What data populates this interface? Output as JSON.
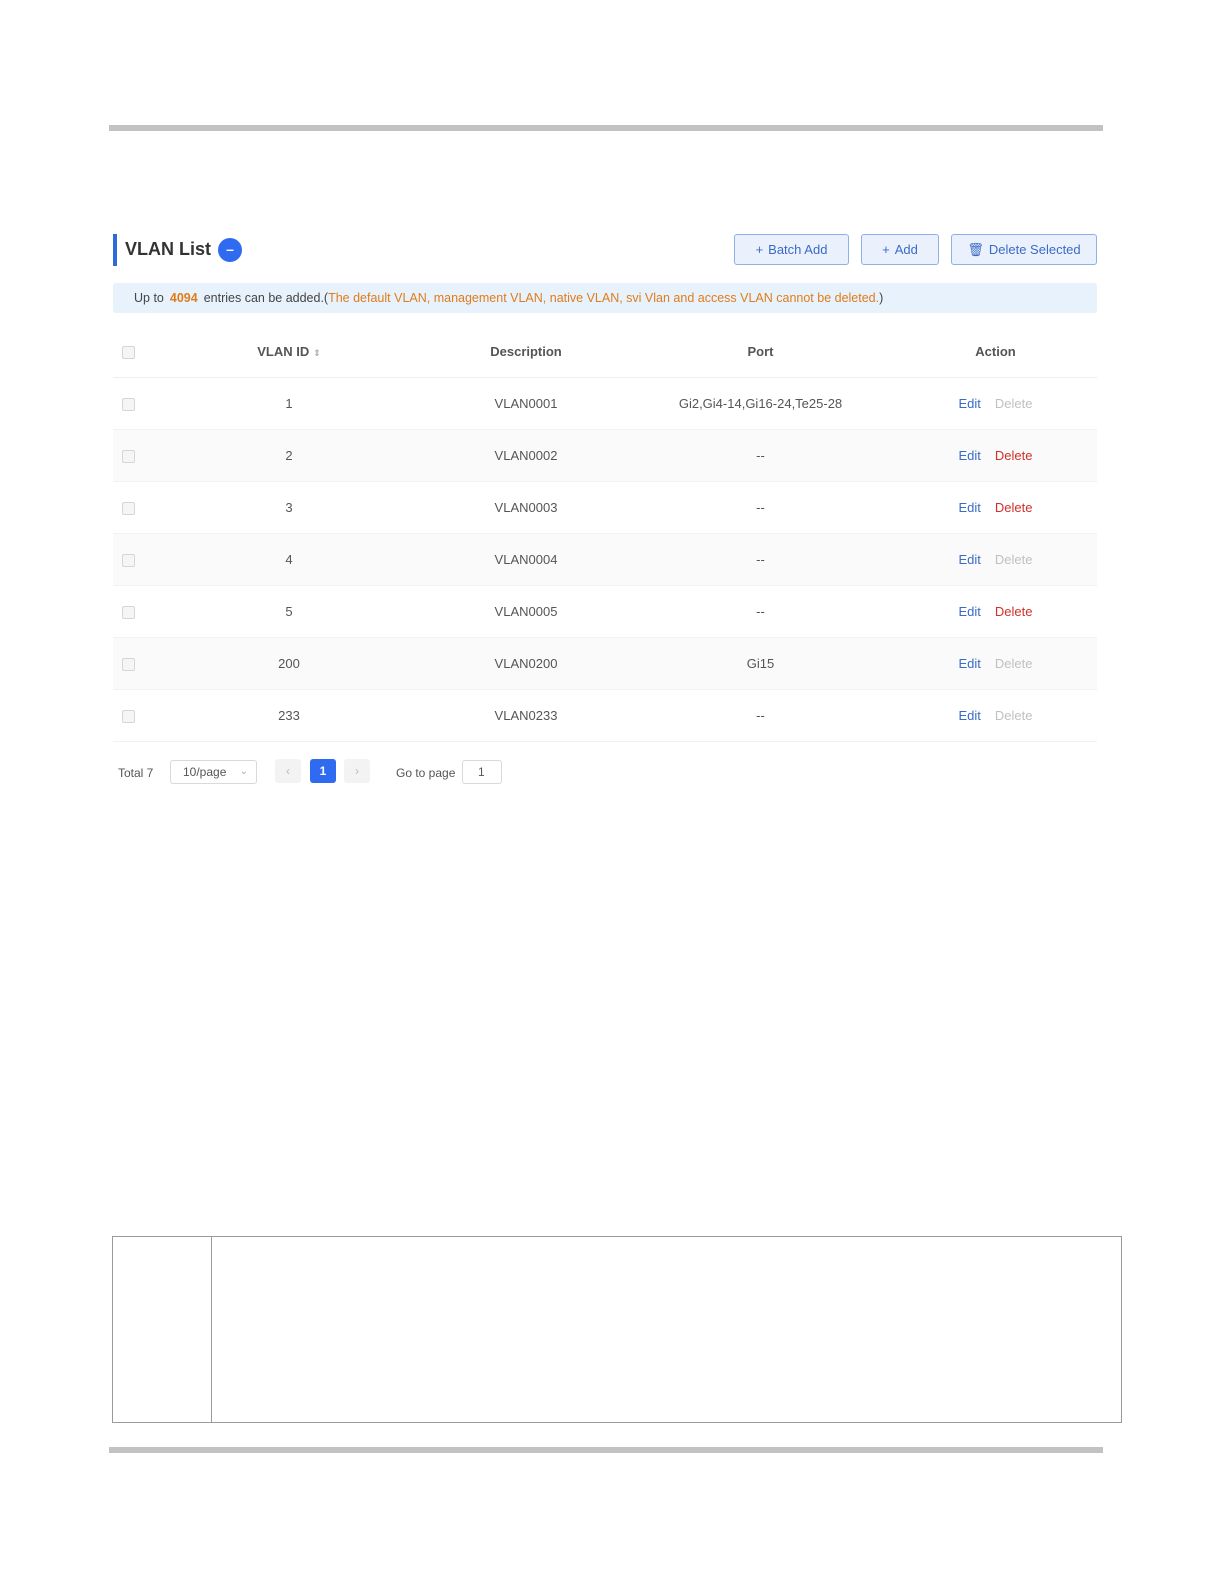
{
  "header": {
    "title": "VLAN List",
    "collapse_symbol": "–",
    "buttons": {
      "batch_add": {
        "icon": "plus-icon",
        "label": "Batch Add"
      },
      "add": {
        "icon": "plus-icon",
        "label": "Add"
      },
      "delete_selected": {
        "icon": "trash-icon",
        "label": "Delete Selected"
      }
    }
  },
  "notice": {
    "prefix": "Up to",
    "max_entries": "4094",
    "suffix": "entries can be added.(",
    "warning": "The default VLAN, management VLAN, native VLAN, svi Vlan and access VLAN cannot be deleted.",
    "close": ")"
  },
  "table": {
    "columns": {
      "id": "VLAN ID",
      "description": "Description",
      "port": "Port",
      "action": "Action"
    },
    "rows": [
      {
        "id": "1",
        "description": "VLAN0001",
        "port": "Gi2,Gi4-14,Gi16-24,Te25-28",
        "edit": "Edit",
        "delete": "Delete",
        "deletable": false
      },
      {
        "id": "2",
        "description": "VLAN0002",
        "port": "--",
        "edit": "Edit",
        "delete": "Delete",
        "deletable": true
      },
      {
        "id": "3",
        "description": "VLAN0003",
        "port": "--",
        "edit": "Edit",
        "delete": "Delete",
        "deletable": true
      },
      {
        "id": "4",
        "description": "VLAN0004",
        "port": "--",
        "edit": "Edit",
        "delete": "Delete",
        "deletable": false
      },
      {
        "id": "5",
        "description": "VLAN0005",
        "port": "--",
        "edit": "Edit",
        "delete": "Delete",
        "deletable": true
      },
      {
        "id": "200",
        "description": "VLAN0200",
        "port": "Gi15",
        "edit": "Edit",
        "delete": "Delete",
        "deletable": false
      },
      {
        "id": "233",
        "description": "VLAN0233",
        "port": "--",
        "edit": "Edit",
        "delete": "Delete",
        "deletable": false
      }
    ]
  },
  "pagination": {
    "total": "Total 7",
    "page_size": "10/page",
    "current_page": "1",
    "goto_label": "Go to page",
    "goto_value": "1"
  },
  "colors": {
    "accent": "#2f6bf0",
    "warning": "#e07c1a",
    "delete_enabled": "#d0302a",
    "delete_disabled": "#c0c0c0"
  }
}
